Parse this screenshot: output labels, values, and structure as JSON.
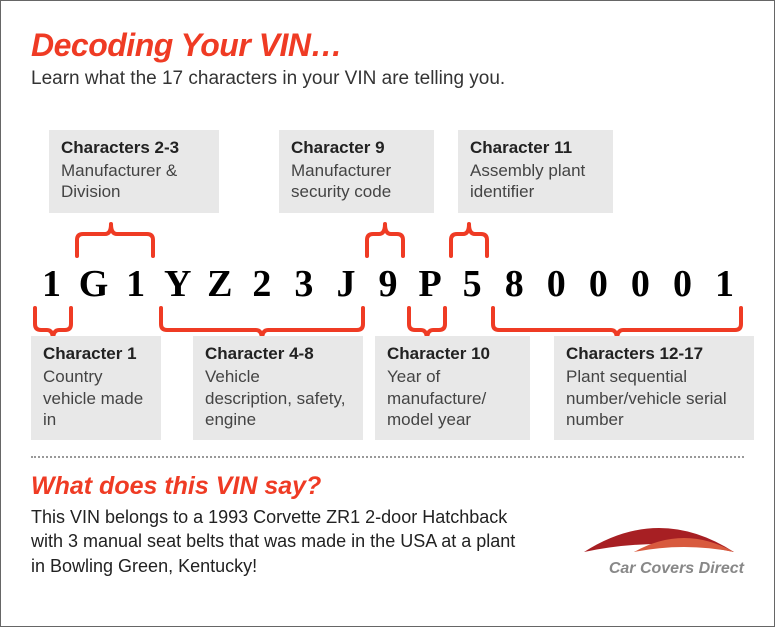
{
  "header": {
    "title": "Decoding Your VIN…",
    "subtitle": "Learn what the 17 characters in your VIN are telling you."
  },
  "top_info": [
    {
      "title": "Characters 2-3",
      "desc": "Manufacturer & Division"
    },
    {
      "title": "Character 9",
      "desc": "Manufacturer security code"
    },
    {
      "title": "Character 11",
      "desc": "Assembly plant identifier"
    }
  ],
  "bottom_info": [
    {
      "title": "Character 1",
      "desc": "Country vehicle made in"
    },
    {
      "title": "Character 4-8",
      "desc": "Vehicle description, safety, engine"
    },
    {
      "title": "Character 10",
      "desc": "Year of manufacture/ model year"
    },
    {
      "title": "Characters 12-17",
      "desc": "Plant sequential number/vehicle serial number"
    }
  ],
  "vin": [
    "1",
    "G",
    "1",
    "Y",
    "Z",
    "2",
    "3",
    "J",
    "9",
    "P",
    "5",
    "8",
    "0",
    "0",
    "0",
    "0",
    "1"
  ],
  "footer": {
    "question": "What does this VIN say?",
    "answer": "This VIN belongs to a 1993 Corvette ZR1 2-door Hatchback with 3 manual seat belts that was made in the USA at a plant in Bowling Green, Kentucky!",
    "logo_text": "Car Covers Direct"
  },
  "chart_data": {
    "type": "table",
    "title": "VIN character position meanings",
    "vin_example": "1G1YZ23J9P5800001",
    "positions": [
      {
        "range": "1",
        "chars": "1",
        "meaning": "Country vehicle made in"
      },
      {
        "range": "2-3",
        "chars": "G1",
        "meaning": "Manufacturer & Division"
      },
      {
        "range": "4-8",
        "chars": "YZ23J",
        "meaning": "Vehicle description, safety, engine"
      },
      {
        "range": "9",
        "chars": "9",
        "meaning": "Manufacturer security code"
      },
      {
        "range": "10",
        "chars": "P",
        "meaning": "Year of manufacture / model year"
      },
      {
        "range": "11",
        "chars": "5",
        "meaning": "Assembly plant identifier"
      },
      {
        "range": "12-17",
        "chars": "800001",
        "meaning": "Plant sequential number / vehicle serial number"
      }
    ],
    "decoded": {
      "year": 1993,
      "model": "Corvette ZR1",
      "body": "2-door Hatchback",
      "restraints": "3 manual seat belts",
      "country": "USA",
      "plant": "Bowling Green, Kentucky"
    }
  }
}
